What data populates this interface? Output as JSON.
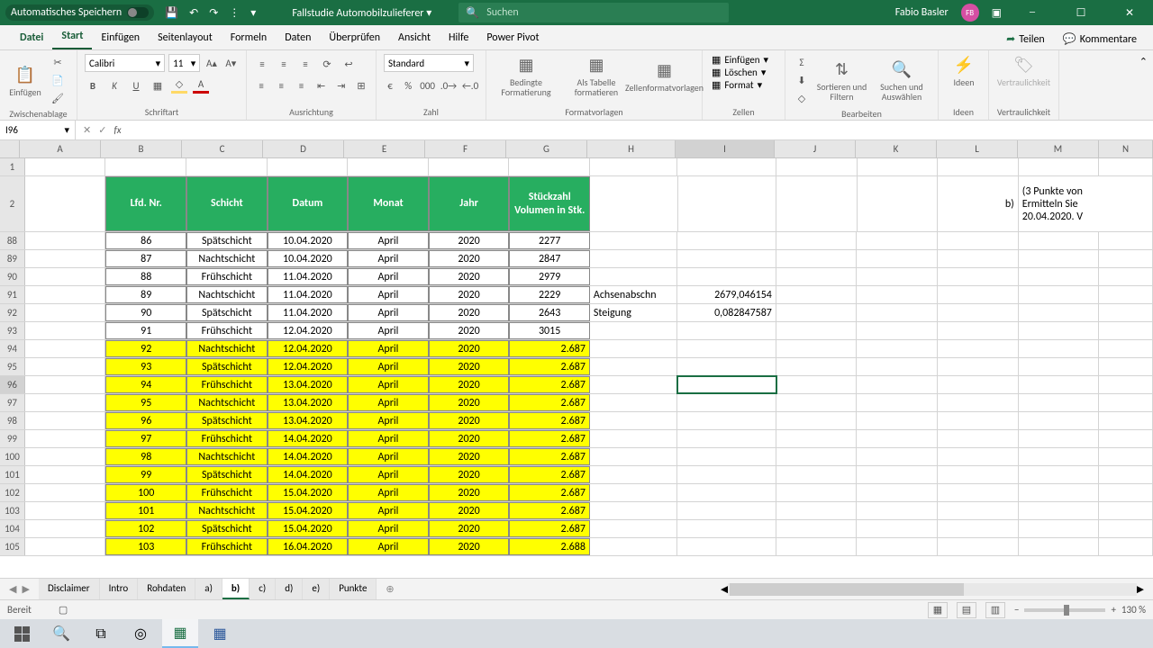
{
  "titlebar": {
    "autosave_label": "Automatisches Speichern",
    "filename": "Fallstudie Automobilzulieferer",
    "search_placeholder": "Suchen",
    "username": "Fabio Basler",
    "avatar": "FB"
  },
  "ribbon_tabs": [
    "Datei",
    "Start",
    "Einfügen",
    "Seitenlayout",
    "Formeln",
    "Daten",
    "Überprüfen",
    "Ansicht",
    "Hilfe",
    "Power Pivot"
  ],
  "ribbon_active_tab": "Start",
  "ribbon_right": {
    "share": "Teilen",
    "comments": "Kommentare"
  },
  "ribbon": {
    "clipboard": {
      "label": "Zwischenablage",
      "paste": "Einfügen"
    },
    "font": {
      "label": "Schriftart",
      "name": "Calibri",
      "size": "11"
    },
    "align": {
      "label": "Ausrichtung"
    },
    "number": {
      "label": "Zahl",
      "format": "Standard"
    },
    "styles": {
      "label": "Formatvorlagen",
      "conditional": "Bedingte Formatierung",
      "astable": "Als Tabelle formatieren",
      "cellstyles": "Zellenformatvorlagen"
    },
    "cells": {
      "label": "Zellen",
      "insert": "Einfügen",
      "delete": "Löschen",
      "format": "Format"
    },
    "editing": {
      "label": "Bearbeiten",
      "sortfilter": "Sortieren und Filtern",
      "findselect": "Suchen und Auswählen"
    },
    "ideas": {
      "label": "Ideen",
      "btn": "Ideen"
    },
    "sensitivity": {
      "label": "Vertraulichkeit",
      "btn": "Vertraulichkeit"
    }
  },
  "namebox": "I96",
  "columns": [
    "A",
    "B",
    "C",
    "D",
    "E",
    "F",
    "G",
    "H",
    "I",
    "J",
    "K",
    "L",
    "M",
    "N"
  ],
  "selected_col": "I",
  "row_start_labels": [
    "1",
    "2"
  ],
  "row_labels": [
    "88",
    "89",
    "90",
    "91",
    "92",
    "93",
    "94",
    "95",
    "96",
    "97",
    "98",
    "99",
    "100",
    "101",
    "102",
    "103",
    "104",
    "105"
  ],
  "selected_row": "96",
  "table_headers": [
    "Lfd. Nr.",
    "Schicht",
    "Datum",
    "Monat",
    "Jahr",
    "Stückzahl Volumen in Stk."
  ],
  "table_rows": [
    {
      "n": "86",
      "s": "Spätschicht",
      "d": "10.04.2020",
      "m": "April",
      "j": "2020",
      "v": "2277",
      "hl": false
    },
    {
      "n": "87",
      "s": "Nachtschicht",
      "d": "10.04.2020",
      "m": "April",
      "j": "2020",
      "v": "2847",
      "hl": false
    },
    {
      "n": "88",
      "s": "Frühschicht",
      "d": "11.04.2020",
      "m": "April",
      "j": "2020",
      "v": "2979",
      "hl": false
    },
    {
      "n": "89",
      "s": "Nachtschicht",
      "d": "11.04.2020",
      "m": "April",
      "j": "2020",
      "v": "2229",
      "hl": false
    },
    {
      "n": "90",
      "s": "Spätschicht",
      "d": "11.04.2020",
      "m": "April",
      "j": "2020",
      "v": "2643",
      "hl": false
    },
    {
      "n": "91",
      "s": "Frühschicht",
      "d": "12.04.2020",
      "m": "April",
      "j": "2020",
      "v": "3015",
      "hl": false
    },
    {
      "n": "92",
      "s": "Nachtschicht",
      "d": "12.04.2020",
      "m": "April",
      "j": "2020",
      "v": "2.687",
      "hl": true
    },
    {
      "n": "93",
      "s": "Spätschicht",
      "d": "12.04.2020",
      "m": "April",
      "j": "2020",
      "v": "2.687",
      "hl": true
    },
    {
      "n": "94",
      "s": "Frühschicht",
      "d": "13.04.2020",
      "m": "April",
      "j": "2020",
      "v": "2.687",
      "hl": true
    },
    {
      "n": "95",
      "s": "Nachtschicht",
      "d": "13.04.2020",
      "m": "April",
      "j": "2020",
      "v": "2.687",
      "hl": true
    },
    {
      "n": "96",
      "s": "Spätschicht",
      "d": "13.04.2020",
      "m": "April",
      "j": "2020",
      "v": "2.687",
      "hl": true
    },
    {
      "n": "97",
      "s": "Frühschicht",
      "d": "14.04.2020",
      "m": "April",
      "j": "2020",
      "v": "2.687",
      "hl": true
    },
    {
      "n": "98",
      "s": "Nachtschicht",
      "d": "14.04.2020",
      "m": "April",
      "j": "2020",
      "v": "2.687",
      "hl": true
    },
    {
      "n": "99",
      "s": "Spätschicht",
      "d": "14.04.2020",
      "m": "April",
      "j": "2020",
      "v": "2.687",
      "hl": true
    },
    {
      "n": "100",
      "s": "Frühschicht",
      "d": "15.04.2020",
      "m": "April",
      "j": "2020",
      "v": "2.687",
      "hl": true
    },
    {
      "n": "101",
      "s": "Nachtschicht",
      "d": "15.04.2020",
      "m": "April",
      "j": "2020",
      "v": "2.687",
      "hl": true
    },
    {
      "n": "102",
      "s": "Spätschicht",
      "d": "15.04.2020",
      "m": "April",
      "j": "2020",
      "v": "2.687",
      "hl": true
    },
    {
      "n": "103",
      "s": "Frühschicht",
      "d": "16.04.2020",
      "m": "April",
      "j": "2020",
      "v": "2.688",
      "hl": true
    }
  ],
  "side_text": {
    "b_label": "b)",
    "b_line1": "(3 Punkte von",
    "b_line2": "Ermitteln Sie",
    "b_line3": "20.04.2020. V",
    "h1": "Achsenabschn",
    "i1": "2679,046154",
    "h2": "Steigung",
    "i2": "0,082847587"
  },
  "sheet_tabs": [
    "Disclaimer",
    "Intro",
    "Rohdaten",
    "a)",
    "b)",
    "c)",
    "d)",
    "e)",
    "Punkte"
  ],
  "active_sheet": "b)",
  "statusbar": {
    "ready": "Bereit",
    "zoom": "130 %"
  }
}
